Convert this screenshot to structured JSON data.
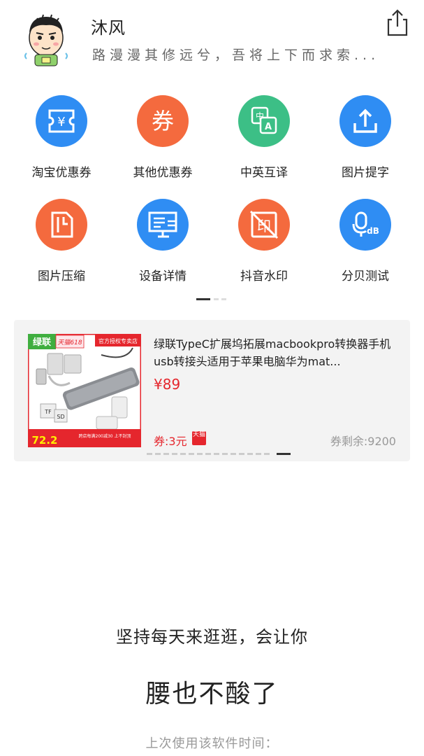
{
  "profile": {
    "name": "沐风",
    "motto": "路漫漫其修远兮，吾将上下而求索..."
  },
  "tools": [
    {
      "label": "淘宝优惠券",
      "icon": "ticket-yuan-icon",
      "color": "#2f8df3"
    },
    {
      "label": "其他优惠券",
      "icon": "coupon-quan-icon",
      "color": "#f46a3e",
      "glyph": "券"
    },
    {
      "label": "中英互译",
      "icon": "translate-icon",
      "color": "#3cbf86"
    },
    {
      "label": "图片提字",
      "icon": "upload-icon",
      "color": "#2f8df3"
    },
    {
      "label": "图片压缩",
      "icon": "compress-file-icon",
      "color": "#f46a3e"
    },
    {
      "label": "设备详情",
      "icon": "monitor-icon",
      "color": "#2f8df3"
    },
    {
      "label": "抖音水印",
      "icon": "no-watermark-icon",
      "color": "#f46a3e",
      "glyph": "印"
    },
    {
      "label": "分贝测试",
      "icon": "decibel-mic-icon",
      "color": "#2f8df3",
      "glyph": "dB"
    }
  ],
  "product": {
    "title": "绿联TypeC扩展坞拓展macbookpro转换器手机usb转接头适用于苹果电脑华为mat...",
    "price": "¥89",
    "coupon": "券:3元",
    "tmall_tag": "天猫",
    "remaining": "券剩余:9200",
    "image": {
      "brand": "绿联",
      "campaign": "天猫618",
      "shop_badge": "官方授权专卖店",
      "tf_label": "TF",
      "sd_label": "SD",
      "promo_price": "72.2",
      "promo_strip": "跨店每满200减30 上不封顶"
    }
  },
  "footer": {
    "slogan_line1": "坚持每天来逛逛，会让你",
    "slogan_line2": "腰也不酸了",
    "last_use": "上次使用该软件时间："
  }
}
